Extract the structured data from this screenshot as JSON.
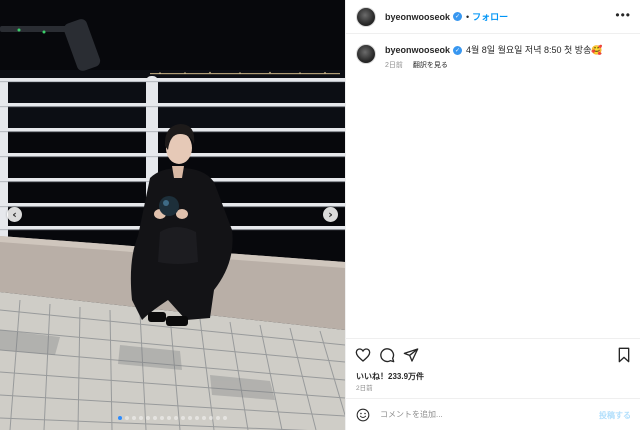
{
  "post": {
    "username": "byeonwooseok",
    "follow_separator": "•",
    "follow_label": "フォロー",
    "more_label": "•••",
    "caption": "4월 8일 월요일 저녁 8:50 첫 방송🥰",
    "caption_time": "2日前",
    "translate_label": "翻訳を見る",
    "likes_text": "いいね！233.9万件",
    "date": "2日前"
  },
  "carousel": {
    "prev_label": "‹",
    "next_label": "›",
    "slide_count": 16,
    "active_index": 0
  },
  "comment": {
    "placeholder": "コメントを追加...",
    "post_label": "投稿する"
  },
  "colors": {
    "link_blue": "#0095f6",
    "verified_blue": "#3897f0",
    "post_disabled": "#b2dffc",
    "muted_text": "#8e8e8e"
  },
  "icons": [
    "verified-badge-icon",
    "heart-icon",
    "comment-icon",
    "share-icon",
    "bookmark-icon",
    "emoji-icon",
    "more-options-icon",
    "chevron-left-icon",
    "chevron-right-icon"
  ]
}
